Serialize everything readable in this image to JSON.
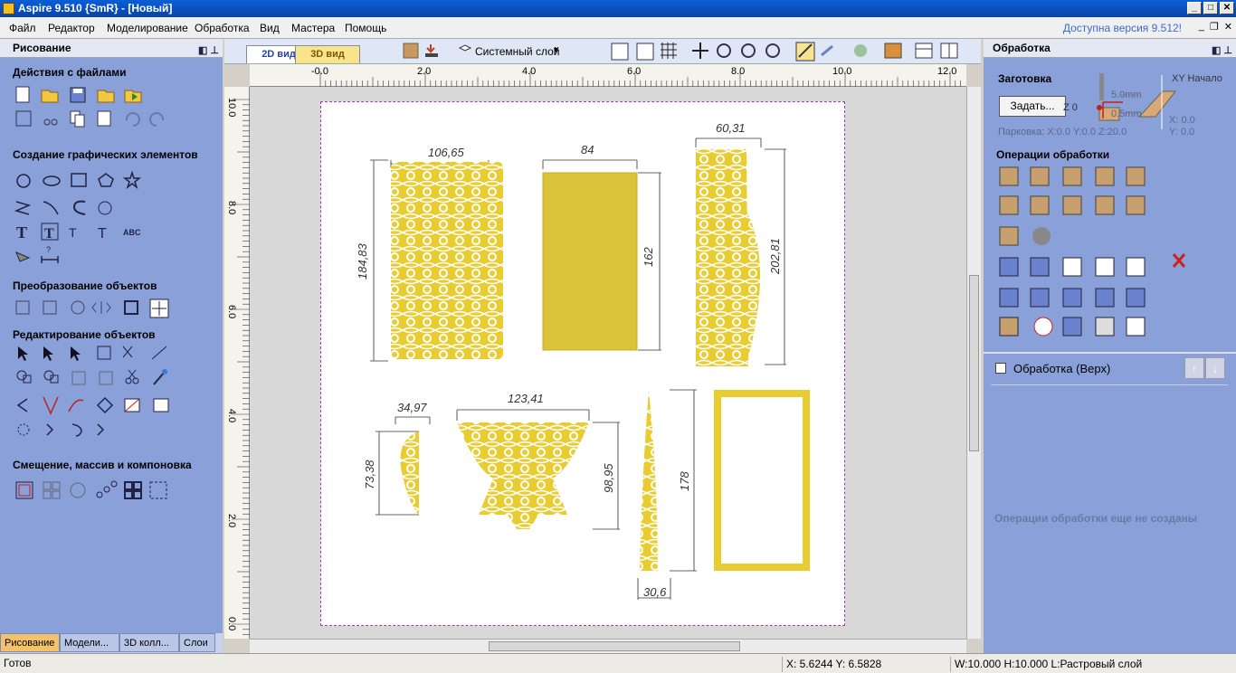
{
  "window": {
    "title": "Aspire 9.510 {SmR} - [Новый]"
  },
  "menu": {
    "items": [
      "Файл",
      "Редактор",
      "Моделирование",
      "Обработка",
      "Вид",
      "Мастера",
      "Помощь"
    ],
    "available_version": "Доступна версия 9.512!"
  },
  "left_panel": {
    "title": "Рисование",
    "sections": [
      "Действия с файлами",
      "Создание графических элементов",
      "Преобразование объектов",
      "Редактирование объектов",
      "Смещение, массив и компоновка"
    ],
    "tabs": [
      "Рисование",
      "Модели...",
      "3D колл...",
      "Слои"
    ]
  },
  "view_toolbar": {
    "tab_2d": "2D вид",
    "tab_3d": "3D вид",
    "layer": "Системный слой"
  },
  "ruler": {
    "h_ticks": [
      "-0.0",
      "2.0",
      "4.0",
      "6.0",
      "8.0",
      "10.0",
      "12.0"
    ],
    "v_ticks": [
      "10.0",
      "8.0",
      "6.0",
      "4.0",
      "2.0",
      "0.0"
    ]
  },
  "dimensions": [
    "106,65",
    "184,83",
    "84",
    "162",
    "60,31",
    "202,81",
    "34,97",
    "73,38",
    "123,41",
    "98,95",
    "178",
    "30,6"
  ],
  "right_panel": {
    "title": "Обработка",
    "stock_label": "Заготовка",
    "set_button": "Задать...",
    "z0_label": "Z 0",
    "thick1": "5.0mm",
    "thick2": "0.5mm",
    "xy_origin": "XY Начало",
    "x_val": "X: 0.0",
    "y_val": "Y: 0.0",
    "parking": "Парковка:  X:0.0 Y:0.0 Z:20.0",
    "ops_label": "Операции обработки",
    "toolpath_group": "Обработка (Верх)",
    "empty_msg": "Операции обработки еще не созданы"
  },
  "status": {
    "ready": "Готов",
    "coords": "X:  5.6244 Y:  6.5828",
    "size": "W:10.000   H:10.000  L:Растровый слой"
  },
  "colors": {
    "panel": "#8aa0d8",
    "shape": "#e8cc30",
    "accent": "#f3c26a"
  }
}
